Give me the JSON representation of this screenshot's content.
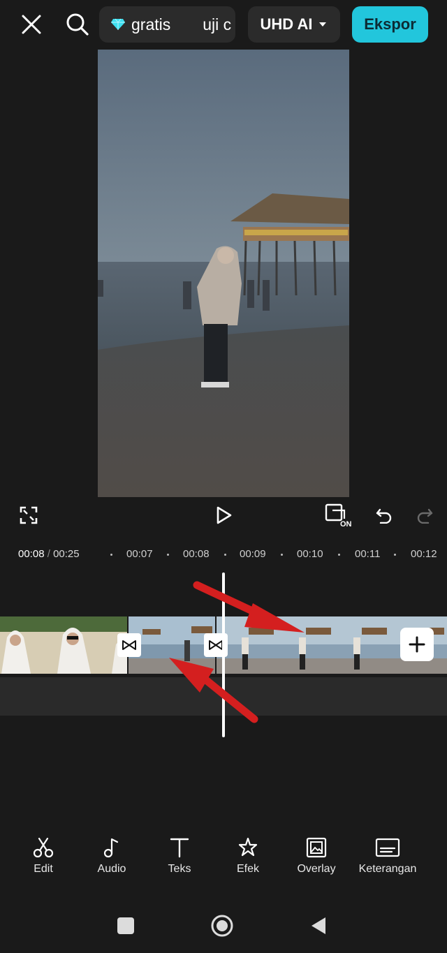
{
  "topbar": {
    "close_icon": "close-icon",
    "search_icon": "search-icon",
    "pro_badge_icon": "diamond-icon",
    "pro_label": "gratis",
    "trial_label": "uji c",
    "resolution_label": "UHD AI",
    "export_label": "Ekspor"
  },
  "preview": {
    "description_icon": "video-frame"
  },
  "controls": {
    "fullscreen_icon": "fullscreen-icon",
    "play_icon": "play-icon",
    "keyframe_icon": "keyframe-on-icon",
    "keyframe_label": "ON",
    "undo_icon": "undo-icon",
    "redo_icon": "redo-icon"
  },
  "timeline": {
    "current_time": "00:08",
    "separator": "/",
    "total_time": "00:25",
    "ruler": [
      "00:07",
      "00:08",
      "00:09",
      "00:10",
      "00:11",
      "00:12"
    ]
  },
  "toolbar": {
    "items": [
      {
        "label": "Edit",
        "icon": "scissors-icon"
      },
      {
        "label": "Audio",
        "icon": "music-note-icon"
      },
      {
        "label": "Teks",
        "icon": "text-icon"
      },
      {
        "label": "Efek",
        "icon": "star-effect-icon"
      },
      {
        "label": "Overlay",
        "icon": "overlay-icon"
      },
      {
        "label": "Keterangan",
        "icon": "captions-icon"
      }
    ]
  },
  "colors": {
    "accent": "#22c6dc",
    "background": "#1a1a1a",
    "annotation_arrow": "#d41f1f"
  }
}
